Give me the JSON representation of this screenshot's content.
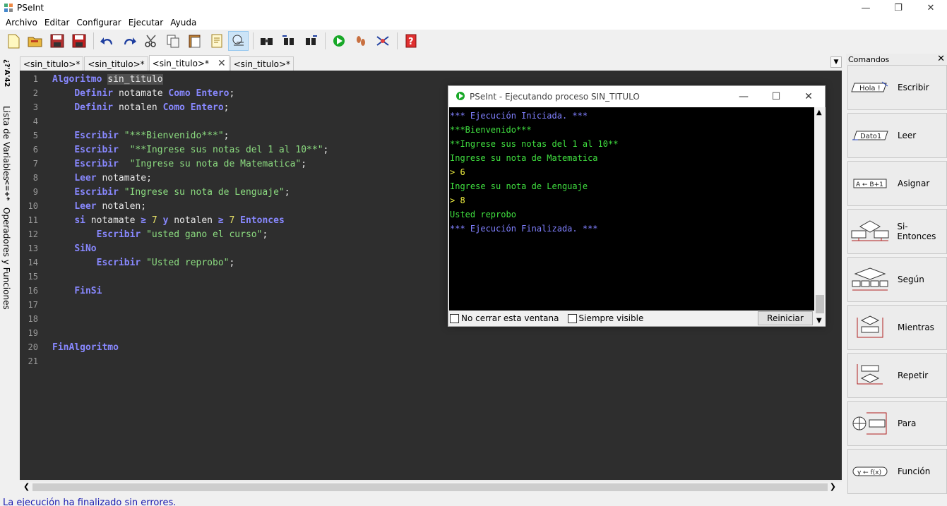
{
  "app": {
    "title": "PSeInt"
  },
  "menu": [
    "Archivo",
    "Editar",
    "Configurar",
    "Ejecutar",
    "Ayuda"
  ],
  "toolbar_icons": [
    "new-file-icon",
    "open-folder-icon",
    "save-icon",
    "save-as-icon",
    "undo-icon",
    "redo-icon",
    "cut-icon",
    "copy-icon",
    "paste-icon",
    "edit-icon",
    "indent-icon",
    "find-icon",
    "find-previous-icon",
    "find-next-icon",
    "run-icon",
    "step-by-step-icon",
    "flowchart-icon",
    "help-icon"
  ],
  "side_tabs": {
    "variables": "Lista de Variables",
    "operators": "Operadores y Funciones"
  },
  "tabs": [
    {
      "label": "<sin_titulo>*"
    },
    {
      "label": "<sin_titulo>*"
    },
    {
      "label": "<sin_titulo>*",
      "active": true
    },
    {
      "label": "<sin_titulo>*"
    }
  ],
  "editor": {
    "lines": [
      {
        "n": "1"
      },
      {
        "n": "2"
      },
      {
        "n": "3"
      },
      {
        "n": "4"
      },
      {
        "n": "5"
      },
      {
        "n": "6"
      },
      {
        "n": "7"
      },
      {
        "n": "8"
      },
      {
        "n": "9"
      },
      {
        "n": "10"
      },
      {
        "n": "11"
      },
      {
        "n": "12"
      },
      {
        "n": "13"
      },
      {
        "n": "14"
      },
      {
        "n": "15"
      },
      {
        "n": "16"
      },
      {
        "n": "17"
      },
      {
        "n": "18"
      },
      {
        "n": "19"
      },
      {
        "n": "20"
      },
      {
        "n": "21"
      }
    ],
    "t": {
      "algoritmo": "Algoritmo",
      "sin_titulo": "sin_titulo",
      "definir": "Definir",
      "notamate": "notamate",
      "notalen": "notalen",
      "como": "Como",
      "entero": "Entero",
      "semi": ";",
      "escribir": "Escribir",
      "leer": "Leer",
      "s5": "\"***Bienvenido***\"",
      "s6": "\"**Ingrese sus notas del 1 al 10**\"",
      "s7": "\"Ingrese su nota de Matematica\"",
      "s9": "\"Ingrese su nota de Lenguaje\"",
      "si": "si",
      "ge": "≥",
      "siete": "7",
      "y": "y",
      "entonces": "Entonces",
      "s12": "\"usted gano el curso\"",
      "sino": "SiNo",
      "s14": "\"Usted reprobo\"",
      "finsi": "FinSi",
      "finalgoritmo": "FinAlgoritmo"
    }
  },
  "status": "La ejecución ha finalizado sin errores.",
  "commands": {
    "title": "Comandos",
    "items": [
      {
        "label": "Escribir",
        "icon": "escribir-icon",
        "glyph": "Hola !"
      },
      {
        "label": "Leer",
        "icon": "leer-icon",
        "glyph": "Dato1"
      },
      {
        "label": "Asignar",
        "icon": "asignar-icon",
        "glyph": "A ← B+1"
      },
      {
        "label": "Si-Entonces",
        "icon": "si-entonces-icon"
      },
      {
        "label": "Según",
        "icon": "segun-icon"
      },
      {
        "label": "Mientras",
        "icon": "mientras-icon"
      },
      {
        "label": "Repetir",
        "icon": "repetir-icon"
      },
      {
        "label": "Para",
        "icon": "para-icon"
      },
      {
        "label": "Función",
        "icon": "funcion-icon",
        "glyph": "y ← f(x)"
      }
    ]
  },
  "run_window": {
    "title": "PSeInt - Ejecutando proceso SIN_TITULO",
    "console": [
      {
        "text": "*** Ejecución Iniciada. ***",
        "cls": "cblue"
      },
      {
        "text": "***Bienvenido***",
        "cls": "cgreen"
      },
      {
        "text": "**Ingrese sus notas del 1 al 10**",
        "cls": "cgreen"
      },
      {
        "text": "Ingrese su nota de Matematica",
        "cls": "cgreen"
      },
      {
        "text": "> 6",
        "cls": "cyellow"
      },
      {
        "text": "Ingrese su nota de Lenguaje",
        "cls": "cgreen"
      },
      {
        "text": "> 8",
        "cls": "cyellow"
      },
      {
        "text": "Usted reprobo",
        "cls": "cgreen"
      },
      {
        "text": "*** Ejecución Finalizada. ***",
        "cls": "cblue"
      }
    ],
    "no_cerrar": "No cerrar esta ventana",
    "siempre_visible": "Siempre visible",
    "reiniciar": "Reiniciar"
  },
  "colors": {
    "editor_bg": "#2e2e2e",
    "keyword": "#8888ff",
    "string": "#8cdc80",
    "number": "#e6e066",
    "status_text": "#1a1ab0"
  }
}
